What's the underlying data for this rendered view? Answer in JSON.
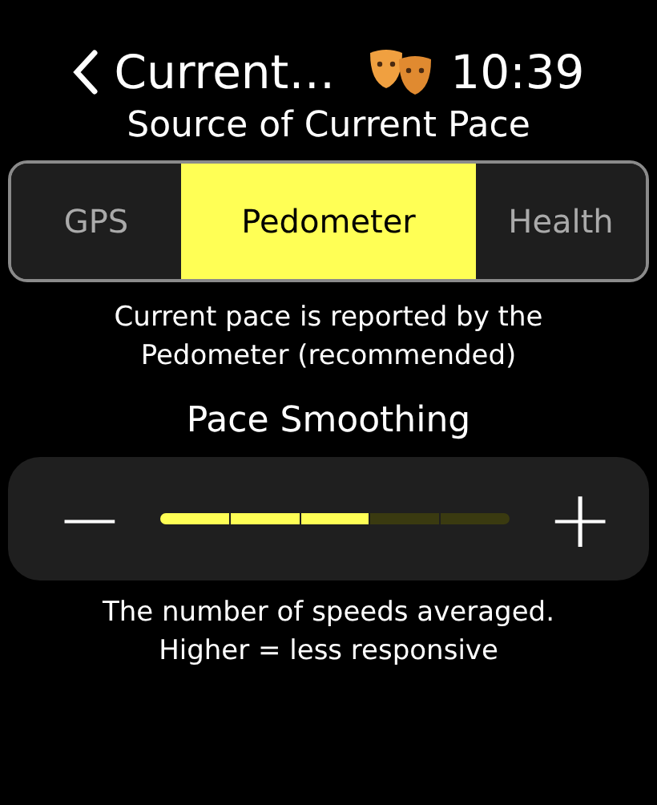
{
  "header": {
    "back_label": "Current…",
    "time": "10:39"
  },
  "source_title": "Source of Current Pace",
  "segments": [
    {
      "label": "GPS",
      "selected": false
    },
    {
      "label": "Pedometer",
      "selected": true
    },
    {
      "label": "Health",
      "selected": false
    }
  ],
  "source_description": "Current pace is reported by the Pedometer (recommended)",
  "smoothing": {
    "title": "Pace Smoothing",
    "minus": "−",
    "plus": "+",
    "level": 0.6
  },
  "smoothing_description": "The number of speeds averaged. Higher = less responsive"
}
